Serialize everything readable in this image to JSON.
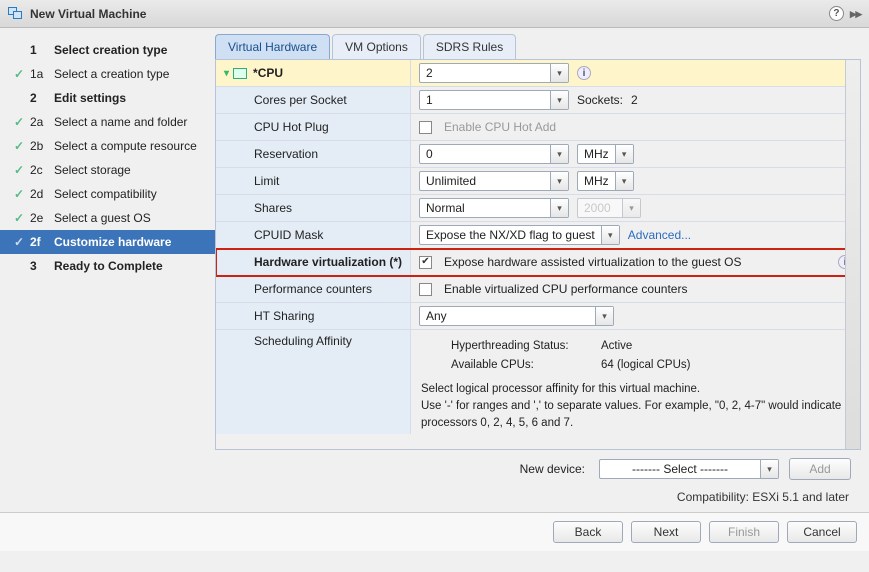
{
  "title": "New Virtual Machine",
  "sidebar": {
    "steps": [
      {
        "num": "1",
        "label": "Select creation type",
        "major": true,
        "done": false,
        "current": false,
        "sub": false
      },
      {
        "num": "1a",
        "label": "Select a creation type",
        "major": false,
        "done": true,
        "current": false,
        "sub": true
      },
      {
        "num": "2",
        "label": "Edit settings",
        "major": true,
        "done": false,
        "current": false,
        "sub": false
      },
      {
        "num": "2a",
        "label": "Select a name and folder",
        "major": false,
        "done": true,
        "current": false,
        "sub": true
      },
      {
        "num": "2b",
        "label": "Select a compute resource",
        "major": false,
        "done": true,
        "current": false,
        "sub": true
      },
      {
        "num": "2c",
        "label": "Select storage",
        "major": false,
        "done": true,
        "current": false,
        "sub": true
      },
      {
        "num": "2d",
        "label": "Select compatibility",
        "major": false,
        "done": true,
        "current": false,
        "sub": true
      },
      {
        "num": "2e",
        "label": "Select a guest OS",
        "major": false,
        "done": true,
        "current": false,
        "sub": true
      },
      {
        "num": "2f",
        "label": "Customize hardware",
        "major": false,
        "done": true,
        "current": true,
        "sub": true
      },
      {
        "num": "3",
        "label": "Ready to Complete",
        "major": true,
        "done": false,
        "current": false,
        "sub": false
      }
    ]
  },
  "tabs": {
    "virtual_hardware": "Virtual Hardware",
    "vm_options": "VM Options",
    "sdrs_rules": "SDRS Rules"
  },
  "hw": {
    "cpu_header": "*CPU",
    "cpu_value": "2",
    "cores_label": "Cores per Socket",
    "cores_value": "1",
    "sockets_label": "Sockets:",
    "sockets_value": "2",
    "hotplug_label": "CPU Hot Plug",
    "hotplug_value": "Enable CPU Hot Add",
    "reservation_label": "Reservation",
    "reservation_value": "0",
    "reservation_unit": "MHz",
    "limit_label": "Limit",
    "limit_value": "Unlimited",
    "limit_unit": "MHz",
    "shares_label": "Shares",
    "shares_value": "Normal",
    "shares_num": "2000",
    "cpuid_label": "CPUID Mask",
    "cpuid_value": "Expose the NX/XD flag to guest",
    "cpuid_adv": "Advanced...",
    "hv_label": "Hardware virtualization (*)",
    "hv_value": "Expose hardware assisted virtualization to the guest OS",
    "perf_label": "Performance counters",
    "perf_value": "Enable virtualized CPU performance counters",
    "ht_label": "HT Sharing",
    "ht_value": "Any",
    "sched_label": "Scheduling Affinity",
    "sched_ht_status_label": "Hyperthreading Status:",
    "sched_ht_status_value": "Active",
    "sched_avail_label": "Available CPUs:",
    "sched_avail_value": "64 (logical CPUs)",
    "sched_text1": "Select logical processor affinity for this virtual machine.",
    "sched_text2": "Use '-' for ranges and ',' to separate values. For example,  \"0, 2, 4-7\" would indicate processors 0, 2, 4, 5, 6 and 7."
  },
  "newdev": {
    "label": "New device:",
    "select": "------- Select -------",
    "add": "Add"
  },
  "compat_label": "Compatibility: ESXi 5.1 and later",
  "footer": {
    "back": "Back",
    "next": "Next",
    "finish": "Finish",
    "cancel": "Cancel"
  }
}
